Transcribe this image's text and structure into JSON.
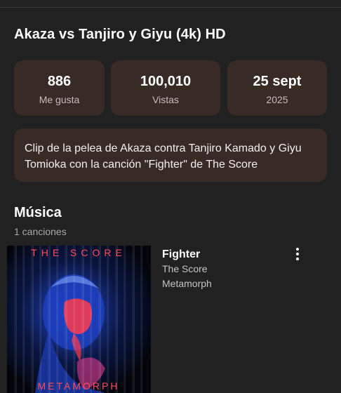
{
  "video": {
    "title": "Akaza vs Tanjiro y Giyu (4k) HD",
    "description": "Clip de la pelea de Akaza contra Tanjiro Kamado y Giyu Tomioka con la canción \"Fighter\" de The Score"
  },
  "stats": {
    "likes": {
      "value": "886",
      "label": "Me gusta"
    },
    "views": {
      "value": "100,010",
      "label": "Vistas"
    },
    "date": {
      "value": "25 sept",
      "label": "2025"
    }
  },
  "music": {
    "heading": "Música",
    "count_label": "1 canciones",
    "tracks": [
      {
        "title": "Fighter",
        "artist": "The Score",
        "album": "Metamorph",
        "cover_text_top": "THE SCORE",
        "cover_text_bottom": "METAMORPH",
        "menu_icon": "more-vert-icon"
      }
    ]
  },
  "colors": {
    "background": "#212121",
    "card": "#382b26",
    "cover_accent_red": "#ff3b4a",
    "cover_accent_blue": "#2f6bff"
  }
}
